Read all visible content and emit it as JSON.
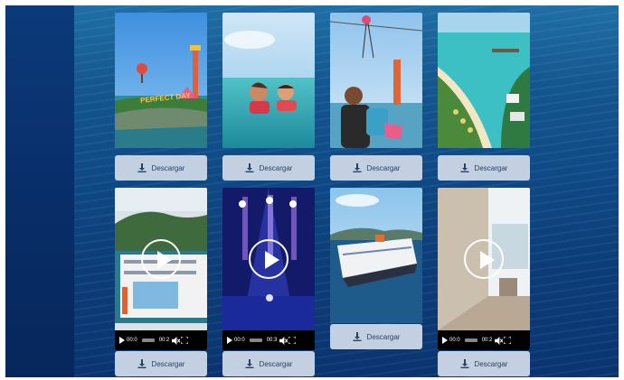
{
  "gallery": {
    "download_label": "Descargar",
    "items": [
      {
        "type": "image",
        "name": "perfect-day-island-photo",
        "sign": "PERFECT DAY"
      },
      {
        "type": "image",
        "name": "family-swimming-photo"
      },
      {
        "type": "image",
        "name": "zipline-photo"
      },
      {
        "type": "image",
        "name": "beach-cabanas-aerial-photo"
      },
      {
        "type": "video",
        "name": "ship-aerial-video",
        "time_current": "00:0",
        "time_total": "00:2"
      },
      {
        "type": "video",
        "name": "aqua-theater-show-video",
        "time_current": "00:0",
        "time_total": "00:3"
      },
      {
        "type": "image",
        "name": "cruise-ship-at-sea-photo"
      },
      {
        "type": "video",
        "name": "stateroom-tour-video",
        "time_current": "00:0",
        "time_total": "00:2"
      }
    ]
  }
}
